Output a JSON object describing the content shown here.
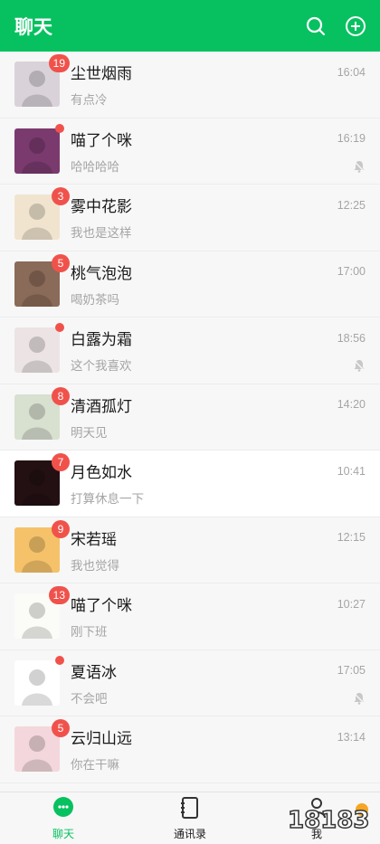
{
  "header": {
    "title": "聊天",
    "icons": [
      "search-icon",
      "add-circle-icon"
    ]
  },
  "chats": [
    {
      "name": "尘世烟雨",
      "preview": "有点冷",
      "time": "16:04",
      "badge": "19",
      "muted": false,
      "avatar_color": "#d9d3d9"
    },
    {
      "name": "喵了个咪",
      "preview": "哈哈哈哈",
      "time": "16:19",
      "badge": "",
      "dot": true,
      "muted": true,
      "avatar_color": "#7a3a6e"
    },
    {
      "name": "雾中花影",
      "preview": "我也是这样",
      "time": "12:25",
      "badge": "3",
      "muted": false,
      "avatar_color": "#f1e4cf"
    },
    {
      "name": "桃气泡泡",
      "preview": "喝奶茶吗",
      "time": "17:00",
      "badge": "5",
      "muted": false,
      "avatar_color": "#8a6a58"
    },
    {
      "name": "白露为霜",
      "preview": "这个我喜欢",
      "time": "18:56",
      "badge": "",
      "dot": true,
      "muted": true,
      "avatar_color": "#ece4e4"
    },
    {
      "name": "清酒孤灯",
      "preview": "明天见",
      "time": "14:20",
      "badge": "8",
      "muted": false,
      "avatar_color": "#d8e0d0"
    },
    {
      "name": "月色如水",
      "preview": "打算休息一下",
      "time": "10:41",
      "badge": "7",
      "muted": false,
      "active": true,
      "avatar_color": "#231013"
    },
    {
      "name": "宋若瑶",
      "preview": "我也觉得",
      "time": "12:15",
      "badge": "9",
      "muted": false,
      "avatar_color": "#f5c26a"
    },
    {
      "name": "喵了个咪",
      "preview": "刚下班",
      "time": "10:27",
      "badge": "13",
      "muted": false,
      "avatar_color": "#fbfbf7"
    },
    {
      "name": "夏语冰",
      "preview": "不会吧",
      "time": "17:05",
      "badge": "",
      "dot": true,
      "muted": true,
      "avatar_color": "#ffffff"
    },
    {
      "name": "云归山远",
      "preview": "你在干嘛",
      "time": "13:14",
      "badge": "5",
      "muted": false,
      "avatar_color": "#f3d7dc"
    }
  ],
  "tabbar": {
    "tabs": [
      {
        "label": "聊天",
        "icon": "chat-bubble-icon",
        "active": true
      },
      {
        "label": "通讯录",
        "icon": "contacts-book-icon",
        "active": false
      },
      {
        "label": "我",
        "icon": "person-icon",
        "active": false
      }
    ]
  },
  "watermark": {
    "text": "18183"
  },
  "colors": {
    "brand": "#07c160",
    "badge": "#f0524b",
    "muted_text": "#a5a5a5"
  }
}
